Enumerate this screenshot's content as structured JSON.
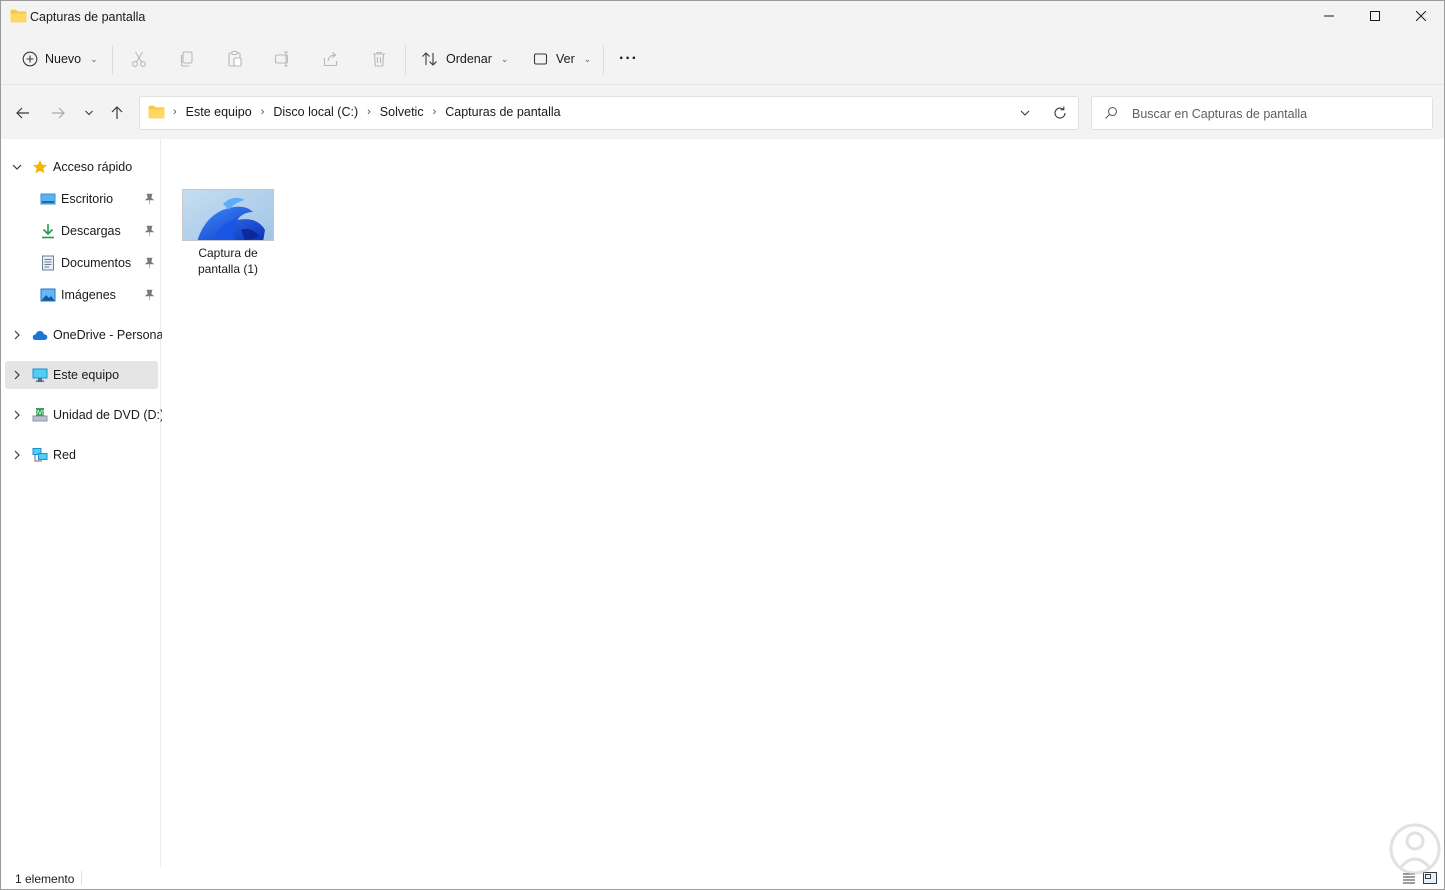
{
  "window": {
    "title": "Capturas de pantalla"
  },
  "toolbar": {
    "new_label": "Nuevo",
    "sort_label": "Ordenar",
    "view_label": "Ver",
    "more_label": "···"
  },
  "address": {
    "crumbs": [
      "Este equipo",
      "Disco local (C:)",
      "Solvetic",
      "Capturas de pantalla"
    ]
  },
  "search": {
    "placeholder": "Buscar en Capturas de pantalla"
  },
  "navpane": {
    "quick_access": "Acceso rápido",
    "items": [
      {
        "label": "Escritorio",
        "icon": "desktop-icon",
        "pinned": true
      },
      {
        "label": "Descargas",
        "icon": "download-icon",
        "pinned": true
      },
      {
        "label": "Documentos",
        "icon": "document-icon",
        "pinned": true
      },
      {
        "label": "Imágenes",
        "icon": "pictures-icon",
        "pinned": true
      }
    ],
    "onedrive": "OneDrive - Personal",
    "this_pc": "Este equipo",
    "dvd": "Unidad de DVD (D:)",
    "network": "Red"
  },
  "files": [
    {
      "name": "Captura de\npantalla (1)",
      "icon": "image-thumbnail"
    }
  ],
  "status": {
    "count": "1 elemento"
  },
  "colors": {
    "chrome": "#f3f3f3",
    "selected": "#e5e5e5",
    "folder": "#f7c843",
    "accent": "#0067c0"
  }
}
